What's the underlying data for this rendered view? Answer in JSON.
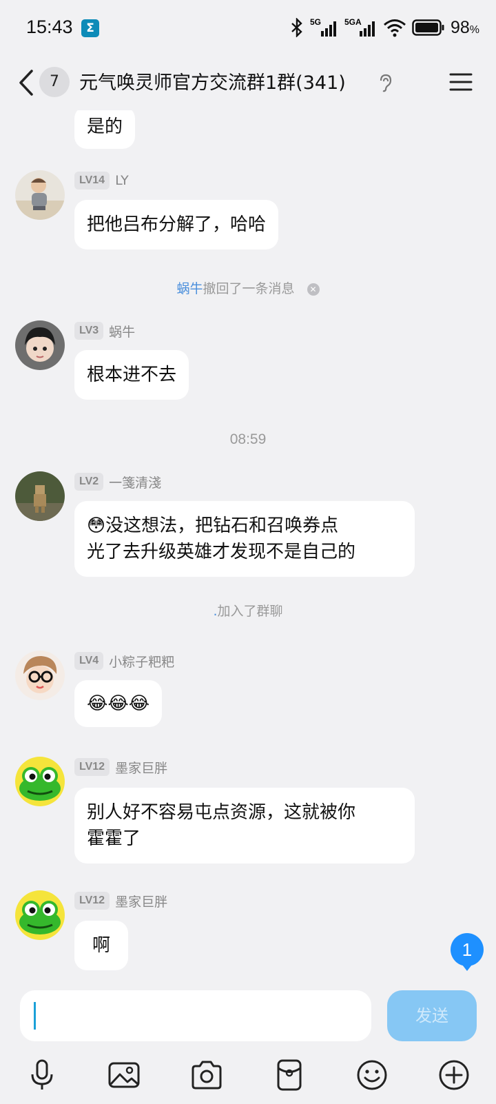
{
  "status_bar": {
    "time": "15:43",
    "app_icon": "Σ",
    "battery_percent": "98",
    "battery_unit": "%",
    "network1": "5G",
    "network2": "5GA"
  },
  "header": {
    "unread_count": "7",
    "title": "元气唤灵师官方交流群1群(341)"
  },
  "messages": [
    {
      "text": "是的"
    },
    {
      "level": "LV14",
      "name": "LY",
      "text": "把他吕布分解了，哈哈"
    },
    {
      "system_name": "蜗牛",
      "system_text": "撤回了一条消息"
    },
    {
      "level": "LV3",
      "name": "蜗牛",
      "text": "根本进不去"
    },
    {
      "timestamp": "08:59"
    },
    {
      "level": "LV2",
      "name": "一箋清淺",
      "text_line1": "没这想法，把钻石和召唤券点",
      "text_line2": "光了去升级英雄才发现不是自己的"
    },
    {
      "join_name": ".",
      "join_text": "加入了群聊"
    },
    {
      "level": "LV4",
      "name": "小粽子粑粑",
      "text": "😂😂😂"
    },
    {
      "level": "LV12",
      "name": "墨家巨胖",
      "text_line1": "别人好不容易屯点资源，这就被你",
      "text_line2": "霍霍了"
    },
    {
      "level": "LV12",
      "name": "墨家巨胖",
      "text": "啊"
    }
  ],
  "new_message_badge": "1",
  "input": {
    "value": "",
    "send_label": "发送"
  },
  "toolbar_icons": [
    "microphone-icon",
    "image-icon",
    "camera-icon",
    "red-packet-icon",
    "emoji-icon",
    "plus-icon"
  ]
}
